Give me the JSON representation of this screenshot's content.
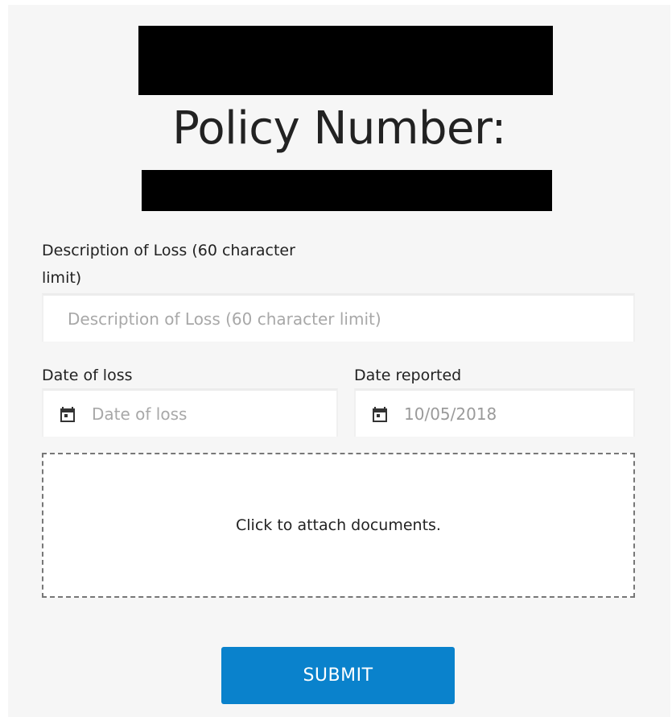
{
  "header": {
    "policy_title": "Policy Number:"
  },
  "form": {
    "description": {
      "label": "Description of Loss (60 character limit)",
      "placeholder": "Description of Loss (60 character limit)"
    },
    "date_of_loss": {
      "label": "Date of loss",
      "placeholder": "Date of loss",
      "icon": "calendar-icon"
    },
    "date_reported": {
      "label": "Date reported",
      "value": "10/05/2018",
      "icon": "calendar-icon"
    },
    "attachments": {
      "text": "Click to attach documents."
    },
    "submit_label": "SUBMIT"
  },
  "colors": {
    "accent": "#0a82cc",
    "card_background": "#f6f6f6",
    "redaction": "#000000"
  }
}
